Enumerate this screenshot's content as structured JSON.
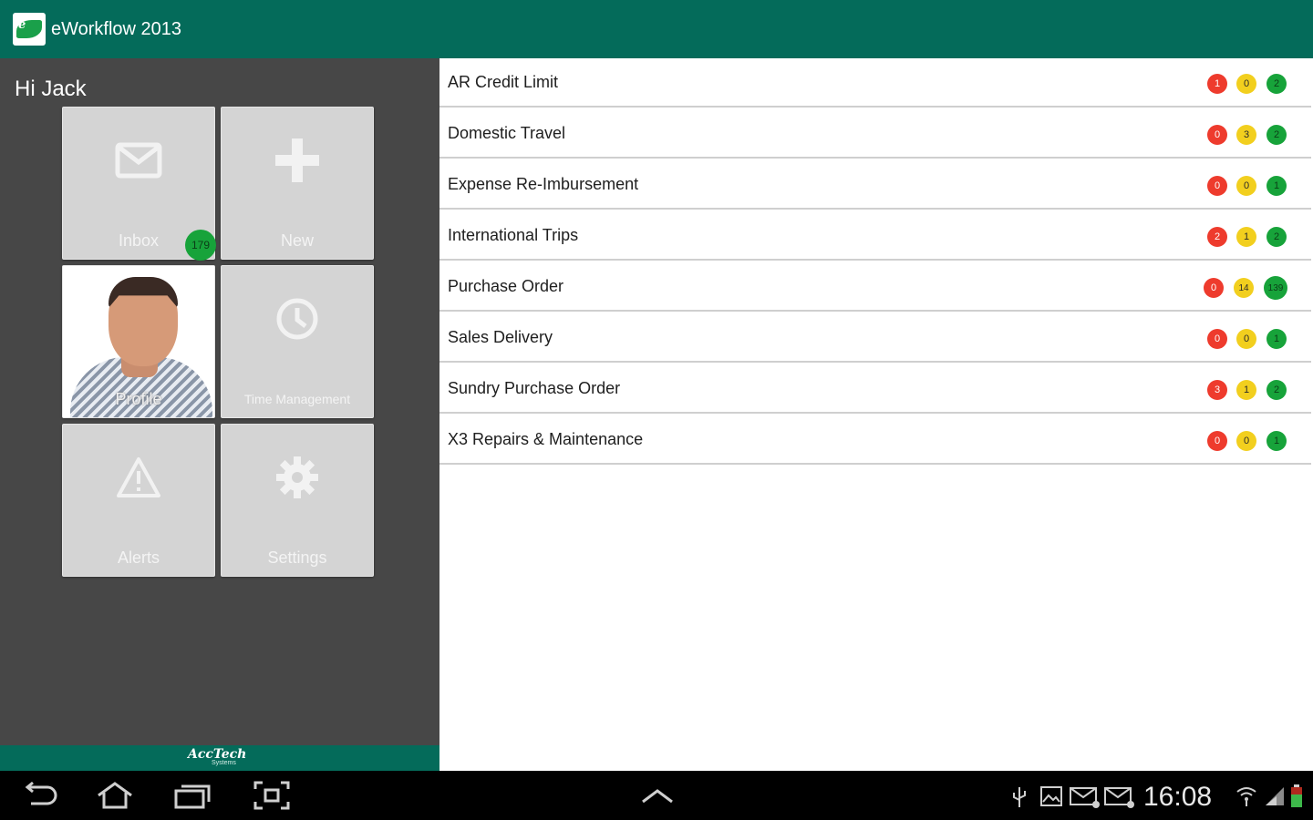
{
  "app": {
    "title": "eWorkflow 2013",
    "colors": {
      "brand": "#046b5a",
      "sidebar": "#474747",
      "tile": "#d4d4d4",
      "red": "#ee3b2d",
      "yellow": "#f2cf1e",
      "green": "#17a33a"
    }
  },
  "sidebar": {
    "greeting": "Hi Jack",
    "tiles": {
      "inbox": {
        "label": "Inbox",
        "icon": "envelope-icon",
        "badge": "179"
      },
      "new": {
        "label": "New",
        "icon": "plus-icon"
      },
      "profile": {
        "label": "Profile",
        "icon": "profile-photo"
      },
      "time": {
        "label": "Time Management",
        "icon": "clock-icon"
      },
      "alerts": {
        "label": "Alerts",
        "icon": "warning-icon"
      },
      "settings": {
        "label": "Settings",
        "icon": "gear-icon"
      }
    },
    "footer": {
      "brand": "AccTech",
      "sub": "Systems"
    }
  },
  "workflows": [
    {
      "name": "AR Credit Limit",
      "red": "1",
      "yellow": "0",
      "green": "2"
    },
    {
      "name": "Domestic Travel",
      "red": "0",
      "yellow": "3",
      "green": "2"
    },
    {
      "name": "Expense Re-Imbursement",
      "red": "0",
      "yellow": "0",
      "green": "1"
    },
    {
      "name": "International Trips",
      "red": "2",
      "yellow": "1",
      "green": "2"
    },
    {
      "name": "Purchase Order",
      "red": "0",
      "yellow": "14",
      "green": "139"
    },
    {
      "name": "Sales Delivery",
      "red": "0",
      "yellow": "0",
      "green": "1"
    },
    {
      "name": "Sundry Purchase Order",
      "red": "3",
      "yellow": "1",
      "green": "2"
    },
    {
      "name": "X3 Repairs & Maintenance",
      "red": "0",
      "yellow": "0",
      "green": "1"
    }
  ],
  "system_bar": {
    "time": "16:08",
    "nav_icons": [
      "back-icon",
      "home-icon",
      "recent-apps-icon",
      "screenshot-icon",
      "up-chevron-icon"
    ],
    "status_icons": [
      "usb-icon",
      "gallery-icon",
      "mail-icon",
      "mail-icon",
      "wifi-icon",
      "signal-icon",
      "battery-icon"
    ]
  }
}
